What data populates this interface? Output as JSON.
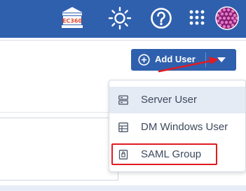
{
  "topbar": {
    "icons": [
      "bank-icon",
      "sun-icon",
      "help-icon",
      "apps-icon",
      "avatar"
    ],
    "bank_icon_text": "EC360",
    "accent": "#2f60ad"
  },
  "add_user_button": {
    "label": "Add User"
  },
  "dropdown": {
    "items": [
      {
        "label": "Server User",
        "icon": "server-icon"
      },
      {
        "label": "DM Windows User",
        "icon": "windows-icon"
      },
      {
        "label": "SAML Group",
        "icon": "saml-lock-icon"
      }
    ],
    "hovered_index": 0,
    "highlighted_index": 2
  },
  "annotation": {
    "color": "#e11b22"
  }
}
